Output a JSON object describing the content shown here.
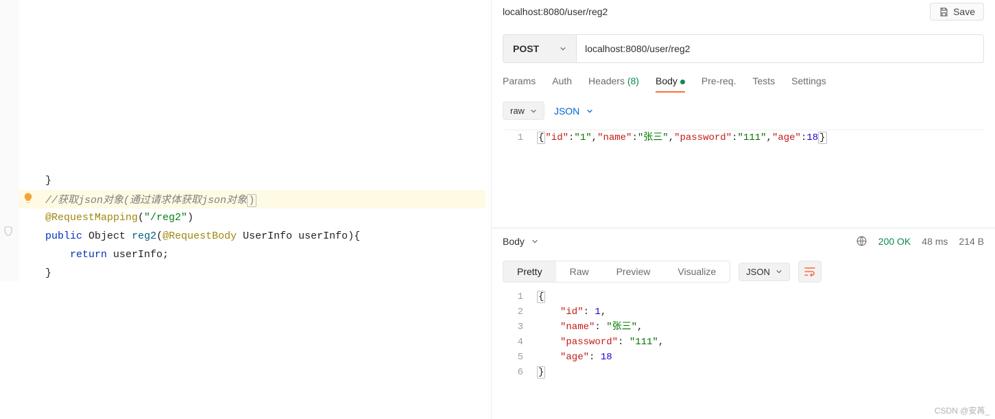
{
  "left": {
    "comment_text": "//获取json对象(通过请求体获取json对象",
    "comment_brace": ")",
    "anno_name": "@RequestMapping",
    "anno_arg": "\"/reg2\"",
    "kw_public": "public",
    "kw_return": "return",
    "type_object": "Object",
    "method": "reg2",
    "anno_body": "@RequestBody",
    "type_userinfo": "UserInfo",
    "param": "userInfo",
    "ret_expr": "userInfo;",
    "brace_close": "}"
  },
  "header": {
    "title": "localhost:8080/user/reg2",
    "save_label": "Save"
  },
  "request": {
    "method": "POST",
    "url": "localhost:8080/user/reg2"
  },
  "tabs": {
    "params": "Params",
    "auth": "Auth",
    "headers_label": "Headers",
    "headers_count": "(8)",
    "body": "Body",
    "prereq": "Pre-req.",
    "tests": "Tests",
    "settings": "Settings"
  },
  "body_sub": {
    "raw": "raw",
    "json": "JSON"
  },
  "req_body": {
    "line_no": "1",
    "open": "{",
    "k1": "\"id\"",
    "c1": ":",
    "v1": "\"1\"",
    "s1": ",",
    "k2": "\"name\"",
    "c2": ":",
    "v2": "\"张三\"",
    "s2": ",",
    "k3": "\"password\"",
    "c3": ":",
    "v3": "\"111\"",
    "s3": ",",
    "k4": "\"age\"",
    "c4": ":",
    "v4": "18",
    "close": "}"
  },
  "response": {
    "body_label": "Body",
    "status": "200 OK",
    "time": "48 ms",
    "size": "214 B",
    "view_pretty": "Pretty",
    "view_raw": "Raw",
    "view_preview": "Preview",
    "view_visualize": "Visualize",
    "lang": "JSON",
    "lines": {
      "n1": "1",
      "n2": "2",
      "n3": "3",
      "n4": "4",
      "n5": "5",
      "n6": "6",
      "open": "{",
      "k1": "\"id\"",
      "v1": "1",
      "c": ": ",
      "s": ",",
      "k2": "\"name\"",
      "v2": "\"张三\"",
      "k3": "\"password\"",
      "v3": "\"111\"",
      "k4": "\"age\"",
      "v4": "18",
      "close": "}"
    }
  },
  "watermark": "CSDN @安苒_"
}
